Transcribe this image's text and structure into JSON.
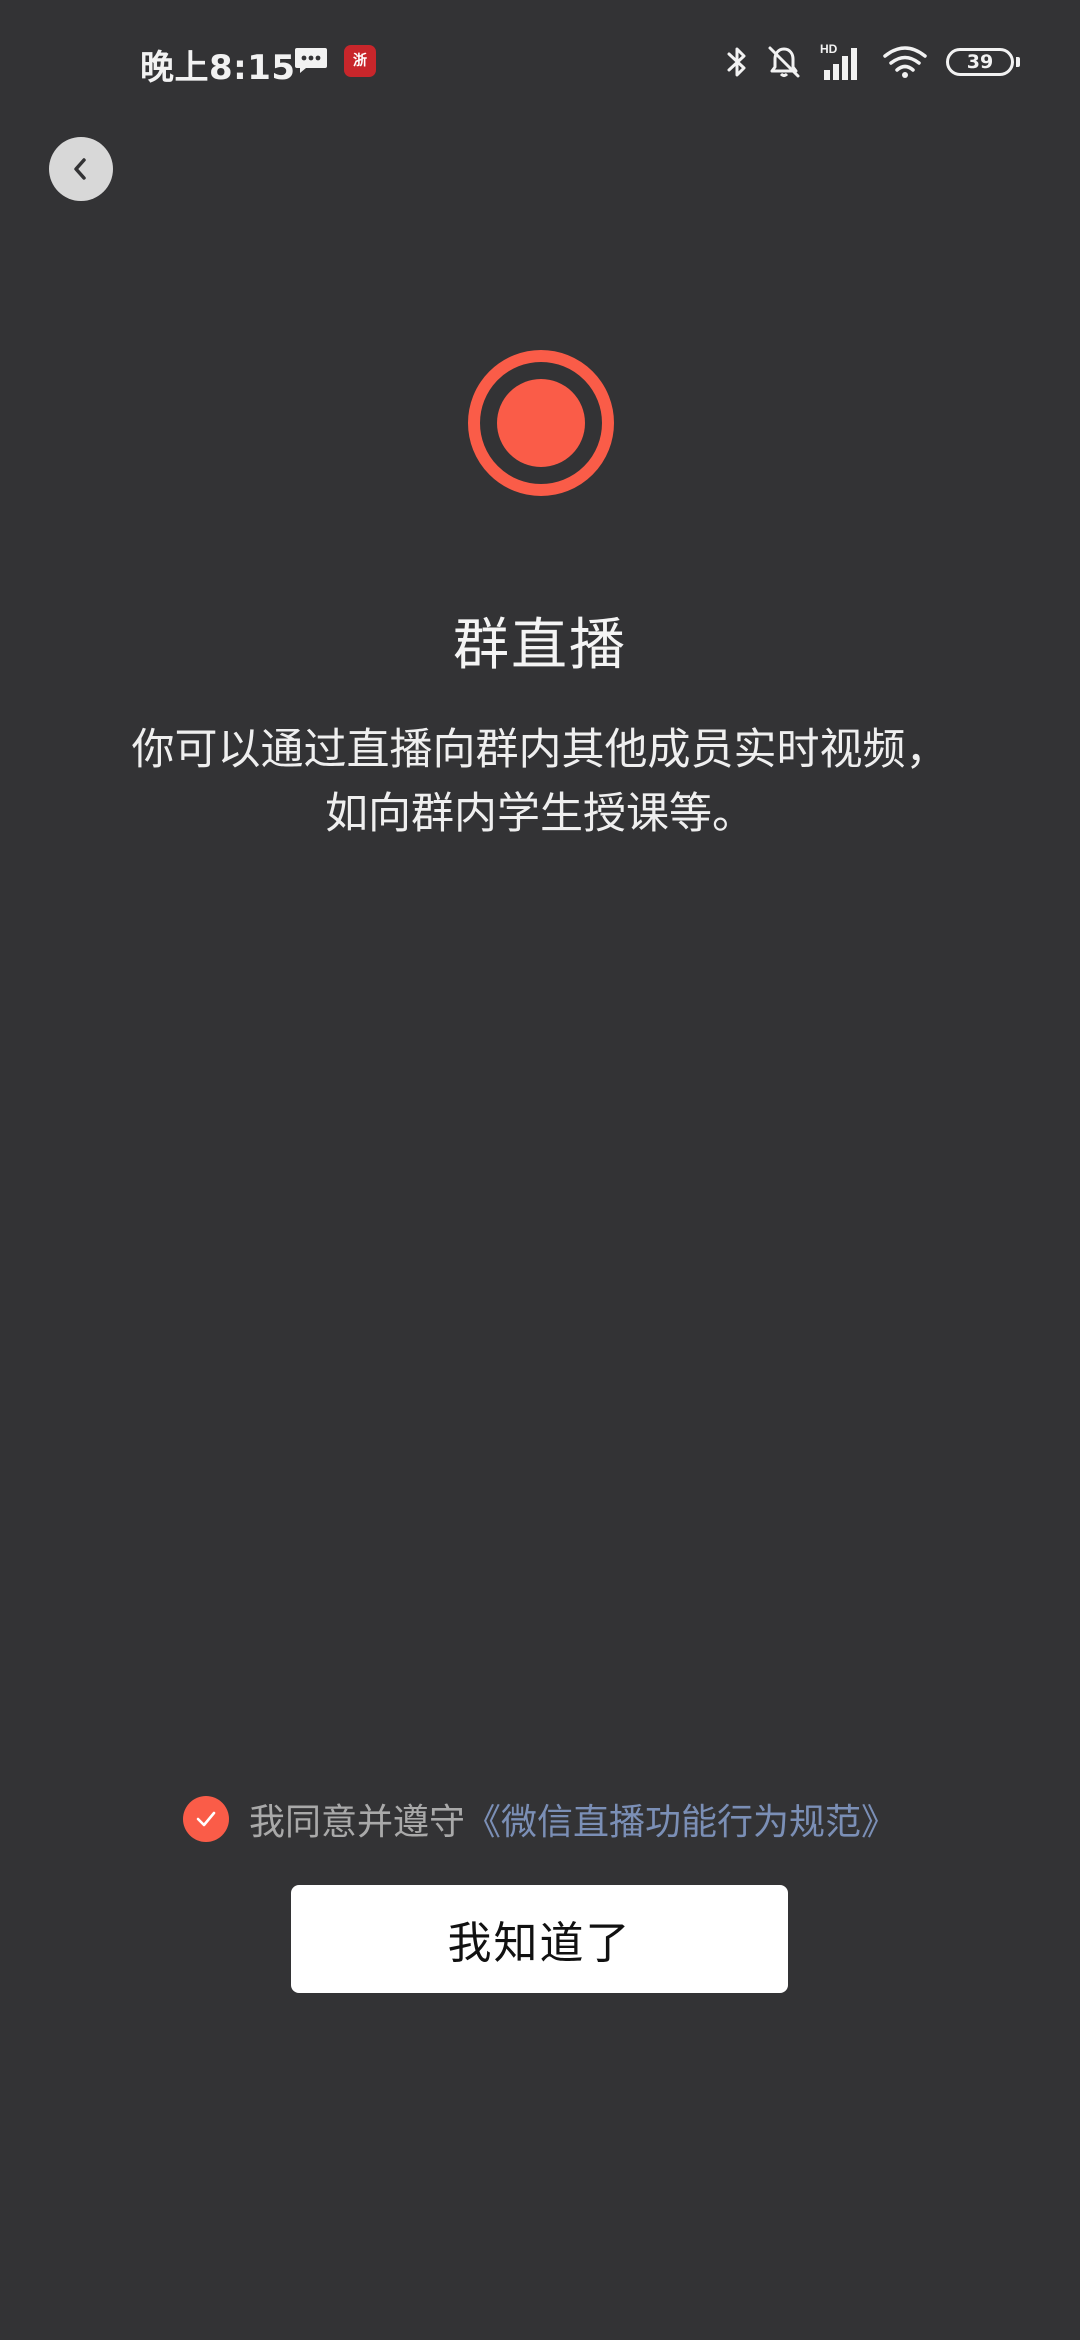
{
  "status_bar": {
    "time": "晚上8:15",
    "news_badge": "浙",
    "battery_level": "39",
    "signal_label": "HD",
    "icons": [
      "message-icon",
      "news-app-icon",
      "bluetooth-icon",
      "mute-icon",
      "signal-icon",
      "wifi-icon",
      "battery-icon"
    ]
  },
  "header": {
    "back_icon": "chevron-left-icon"
  },
  "main": {
    "icon": "record-icon",
    "title": "群直播",
    "description_line1": "你可以通过直播向群内其他成员实时视频，",
    "description_line2": "如向群内学生授课等。"
  },
  "agreement": {
    "checked": true,
    "prefix": "我同意并遵守",
    "link": "《微信直播功能行为规范》"
  },
  "actions": {
    "confirm_label": "我知道了"
  },
  "colors": {
    "background": "#333335",
    "accent": "#fa5c48",
    "link": "#7b8fb6",
    "button_bg": "#ffffff"
  }
}
